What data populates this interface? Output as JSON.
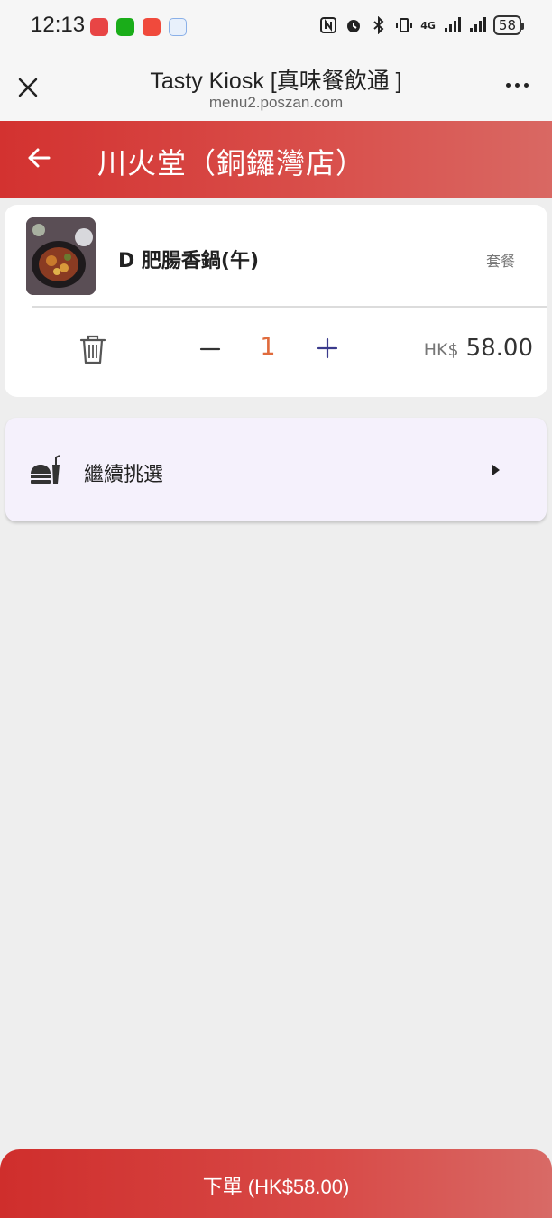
{
  "status_bar": {
    "time": "12:13",
    "battery": "58",
    "network": "4G"
  },
  "browser": {
    "title": "Tasty Kiosk [真味餐飲通 ]",
    "url": "menu2.poszan.com"
  },
  "header": {
    "store_name": "川火堂（銅鑼灣店）"
  },
  "cart": {
    "items": [
      {
        "name": "D 肥腸香鍋(午)",
        "tag": "套餐",
        "quantity": "1",
        "currency": "HK$",
        "price": "58.00"
      }
    ]
  },
  "continue": {
    "label": "繼續挑選"
  },
  "footer": {
    "order_label": "下單 (HK$58.00)"
  },
  "colors": {
    "brand_red": "#d33230",
    "qty_accent": "#e06b3c",
    "plus_icon": "#3a3a8c"
  }
}
